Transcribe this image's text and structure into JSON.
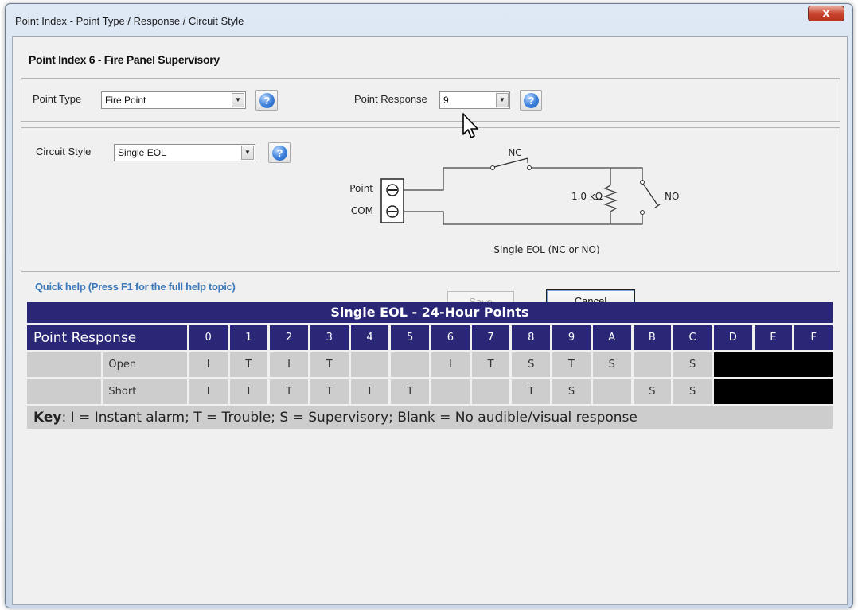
{
  "window": {
    "title": "Point Index - Point Type / Response / Circuit Style",
    "close_label": "x"
  },
  "header": {
    "title": "Point Index 6 - Fire Panel Supervisory"
  },
  "point_type": {
    "label": "Point Type",
    "value": "Fire Point"
  },
  "point_response": {
    "label": "Point Response",
    "value": "9"
  },
  "circuit_style": {
    "label": "Circuit Style",
    "value": "Single EOL"
  },
  "diagram": {
    "point_label": "Point",
    "com_label": "COM",
    "nc_label": "NC",
    "no_label": "NO",
    "resistor_label": "1.0 kΩ",
    "caption": "Single EOL (NC or NO)"
  },
  "quick_help": "Quick help (Press F1 for the full help topic)",
  "buttons": {
    "save": "Save",
    "cancel": "Cancel"
  },
  "response_table": {
    "title": "Single EOL - 24-Hour Points",
    "header_label": "Point Response",
    "columns": [
      "0",
      "1",
      "2",
      "3",
      "4",
      "5",
      "6",
      "7",
      "8",
      "9",
      "A",
      "B",
      "C",
      "D",
      "E",
      "F"
    ],
    "rows": [
      {
        "label": "Open",
        "values": [
          "I",
          "T",
          "I",
          "T",
          "",
          "",
          "I",
          "T",
          "S",
          "T",
          "S",
          "",
          "S"
        ]
      },
      {
        "label": "Short",
        "values": [
          "I",
          "I",
          "T",
          "T",
          "I",
          "T",
          "",
          "",
          "T",
          "S",
          "",
          "S",
          "S"
        ]
      }
    ],
    "key_bold": "Key",
    "key_text": ": I = Instant alarm; T = Trouble; S = Supervisory; Blank = No audible/visual response"
  },
  "colors": {
    "table_header": "#2a2776",
    "table_cell": "#cdcdcd",
    "quick_help": "#3b78ba",
    "close_button": "#c8452f"
  }
}
